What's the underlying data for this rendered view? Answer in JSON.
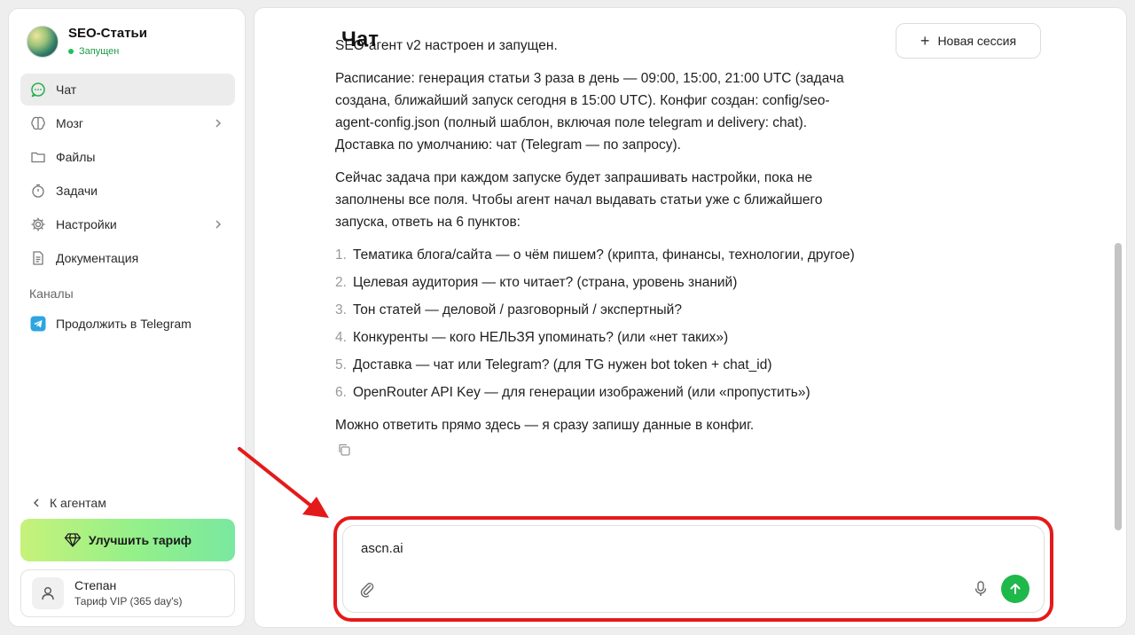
{
  "sidebar": {
    "brand_title": "SEO-Статьи",
    "brand_status": "Запущен",
    "items": [
      {
        "label": "Чат",
        "icon": "chat-icon"
      },
      {
        "label": "Мозг",
        "icon": "brain-icon"
      },
      {
        "label": "Файлы",
        "icon": "folder-icon"
      },
      {
        "label": "Задачи",
        "icon": "timer-icon"
      },
      {
        "label": "Настройки",
        "icon": "gear-icon"
      },
      {
        "label": "Документация",
        "icon": "document-icon"
      }
    ],
    "channels_label": "Каналы",
    "telegram_label": "Продолжить в Telegram",
    "back_label": "К агентам",
    "upgrade_label": "Улучшить тариф",
    "user_name": "Степан",
    "user_plan": "Тариф VIP (365 day's)"
  },
  "header": {
    "title": "Чат",
    "new_session_label": "Новая сессия"
  },
  "message": {
    "cut_line": "SEO-агент v2 настроен и запущен.",
    "para1": "Расписание: генерация статьи 3 раза в день — 09:00, 15:00, 21:00 UTC (задача создана, ближайший запуск сегодня в 15:00 UTC). Конфиг создан: config/seo-agent-config.json (полный шаблон, включая поле telegram и delivery: chat). Доставка по умолчанию: чат (Telegram — по запросу).",
    "para2": "Сейчас задача при каждом запуске будет запрашивать настройки, пока не заполнены все поля. Чтобы агент начал выдавать статьи уже с ближайшего запуска, ответь на 6 пунктов:",
    "items": [
      "Тематика блога/сайта — о чём пишем? (крипта, финансы, технологии, другое)",
      "Целевая аудитория — кто читает? (страна, уровень знаний)",
      "Тон статей — деловой / разговорный / экспертный?",
      "Конкуренты — кого НЕЛЬЗЯ упоминать? (или «нет таких»)",
      "Доставка — чат или Telegram? (для TG нужен bot token + chat_id)",
      "OpenRouter API Key — для генерации изображений (или «пропустить»)"
    ],
    "para3": "Можно ответить прямо здесь — я сразу запишу данные в конфиг."
  },
  "composer": {
    "value": "ascn.ai"
  },
  "colors": {
    "accent_green": "#1fb84a",
    "annotation_red": "#e41a1a"
  }
}
